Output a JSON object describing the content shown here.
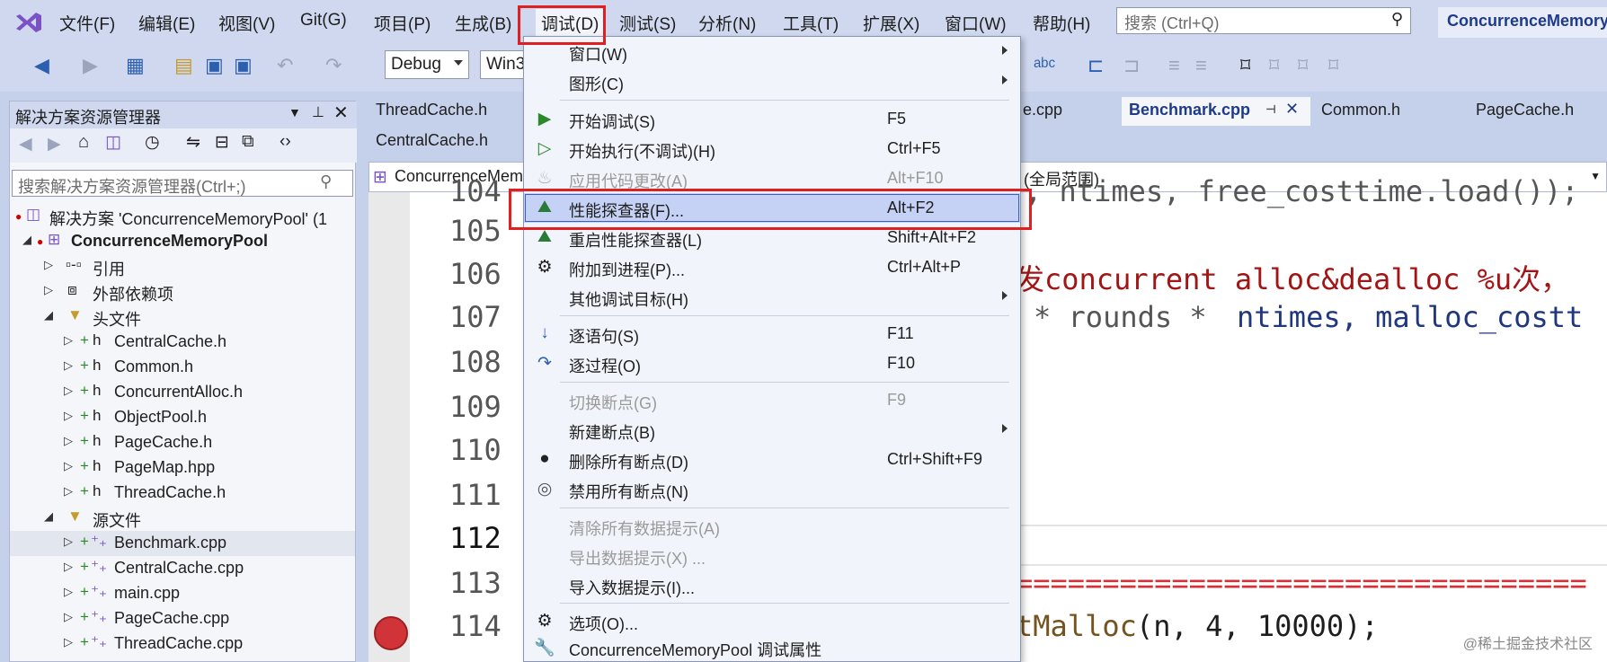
{
  "menubar": {
    "items": [
      "文件(F)",
      "编辑(E)",
      "视图(V)",
      "Git(G)",
      "项目(P)",
      "生成(B)",
      "调试(D)",
      "测试(S)",
      "分析(N)",
      "工具(T)",
      "扩展(X)",
      "窗口(W)",
      "帮助(H)"
    ],
    "search_placeholder": "搜索 (Ctrl+Q)",
    "title": "ConcurrenceMemoryPool"
  },
  "toolbar": {
    "config": "Debug",
    "platform": "Win32"
  },
  "solution_explorer": {
    "title": "解决方案资源管理器",
    "search_placeholder": "搜索解决方案资源管理器(Ctrl+;)",
    "solution": "解决方案 'ConcurrenceMemoryPool' (1",
    "project": "ConcurrenceMemoryPool",
    "references": "引用",
    "external": "外部依赖项",
    "headers_folder": "头文件",
    "headers": [
      "CentralCache.h",
      "Common.h",
      "ConcurrentAlloc.h",
      "ObjectPool.h",
      "PageCache.h",
      "PageMap.hpp",
      "ThreadCache.h"
    ],
    "sources_folder": "源文件",
    "sources": [
      "Benchmark.cpp",
      "CentralCache.cpp",
      "main.cpp",
      "PageCache.cpp",
      "ThreadCache.cpp"
    ]
  },
  "editor": {
    "tabs_row1": [
      "ThreadCache.h",
      "e.cpp",
      "Benchmark.cpp",
      "Common.h",
      "PageCache.h"
    ],
    "tabs_row2": [
      "CentralCache.h"
    ],
    "nav_project": "ConcurrenceMem",
    "nav_scope": "(全局范围)",
    "line_numbers": [
      "104",
      "105",
      "106",
      "107",
      "108",
      "109",
      "110",
      "111",
      "112",
      "113",
      "114"
    ],
    "code": {
      "l104": ", ntimes, free_costtime.load());",
      "l106": "发concurrent alloc&dealloc %u次，",
      "l107a": "* rounds *",
      "l107b": "ntimes, malloc_costt",
      "l113": "=================================",
      "l114a": "tMalloc",
      "l114b": "(n, 4, 10000);"
    }
  },
  "debug_menu": {
    "items": [
      {
        "label": "窗口(W)",
        "shortcut": "",
        "submenu": true,
        "icon": ""
      },
      {
        "label": "图形(C)",
        "shortcut": "",
        "submenu": true,
        "icon": ""
      },
      {
        "label": "开始调试(S)",
        "shortcut": "F5",
        "icon": "play-icon"
      },
      {
        "label": "开始执行(不调试)(H)",
        "shortcut": "Ctrl+F5",
        "icon": "play-outline-icon"
      },
      {
        "label": "应用代码更改(A)",
        "shortcut": "Alt+F10",
        "icon": "flame-icon",
        "disabled": true
      },
      {
        "label": "性能探查器(F)...",
        "shortcut": "Alt+F2",
        "icon": "profiler-icon",
        "highlighted": true
      },
      {
        "label": "重启性能探查器(L)",
        "shortcut": "Shift+Alt+F2",
        "icon": "profiler-restart-icon"
      },
      {
        "label": "附加到进程(P)...",
        "shortcut": "Ctrl+Alt+P",
        "icon": "attach-gear-icon"
      },
      {
        "label": "其他调试目标(H)",
        "shortcut": "",
        "submenu": true,
        "icon": ""
      },
      {
        "label": "逐语句(S)",
        "shortcut": "F11",
        "icon": "step-into-icon"
      },
      {
        "label": "逐过程(O)",
        "shortcut": "F10",
        "icon": "step-over-icon"
      },
      {
        "label": "切换断点(G)",
        "shortcut": "F9",
        "icon": "",
        "disabled": true
      },
      {
        "label": "新建断点(B)",
        "shortcut": "",
        "submenu": true,
        "icon": ""
      },
      {
        "label": "删除所有断点(D)",
        "shortcut": "Ctrl+Shift+F9",
        "icon": "delete-breakpoints-icon"
      },
      {
        "label": "禁用所有断点(N)",
        "shortcut": "",
        "icon": "disable-breakpoints-icon"
      },
      {
        "label": "清除所有数据提示(A)",
        "shortcut": "",
        "icon": "",
        "disabled": true
      },
      {
        "label": "导出数据提示(X) ...",
        "shortcut": "",
        "icon": "",
        "disabled": true
      },
      {
        "label": "导入数据提示(I)...",
        "shortcut": "",
        "icon": ""
      },
      {
        "label": "选项(O)...",
        "shortcut": "",
        "icon": "gear-icon"
      },
      {
        "label": "ConcurrenceMemoryPool 调试属性",
        "shortcut": "",
        "icon": "wrench-icon"
      }
    ]
  },
  "watermark": "@稀土掘金技术社区",
  "colors": {
    "accent": "#3a5fc8",
    "highlight_box": "#e02020",
    "breakpoint": "#d13438"
  }
}
